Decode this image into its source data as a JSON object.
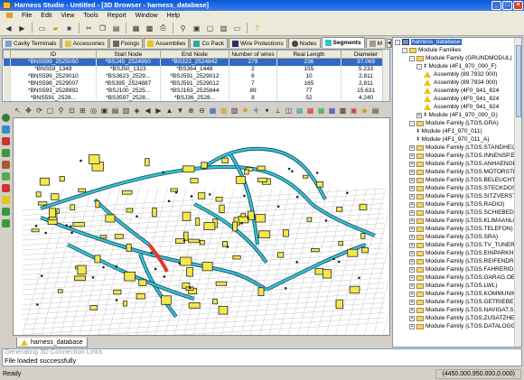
{
  "window": {
    "title": "Harness Studio - Untitled - [3D Browser - harness_database]"
  },
  "menu": [
    "File",
    "Edit",
    "View",
    "Tools",
    "Report",
    "Window",
    "Help"
  ],
  "tabs": [
    {
      "label": "Cavity Terminals",
      "icon": "cavity-terminal-icon"
    },
    {
      "label": "Accessories",
      "icon": "accessory-icon"
    },
    {
      "label": "Fixings",
      "icon": "fixing-icon"
    },
    {
      "label": "Assemblies",
      "icon": "assembly-icon"
    },
    {
      "label": "Co Pack",
      "icon": "copack-icon"
    },
    {
      "label": "Wire Protections",
      "icon": "wire-protection-icon"
    },
    {
      "label": "Nodes",
      "icon": "node-icon"
    },
    {
      "label": "Segments",
      "icon": "segment-icon"
    },
    {
      "label": "M",
      "icon": "more-icon"
    }
  ],
  "grid": {
    "columns": [
      "ID",
      "Start Node",
      "End Node",
      "Number of wires",
      "Real Length",
      "Diameter"
    ],
    "rows": [
      [
        "*BNS599_2525050",
        "*BSJ45_2524950",
        "*BS322_2524842",
        "279",
        "236",
        "37.069"
      ],
      [
        "*BNS59_1349",
        "*BSJ50_1323",
        "*BS364_1448",
        "2",
        "155",
        "5.233"
      ],
      [
        "*BNS599_2529010",
        "*BS3623_2529...",
        "*BSJ591_2529012",
        "6",
        "10",
        "2.811"
      ],
      [
        "*BNS598_2529007",
        "*BS395_2524887",
        "*BSJ591_2529012",
        "7",
        "165",
        "2.811"
      ],
      [
        "*BNS593_2528992",
        "*BSJ100_2525...",
        "*BSJ163_2525844",
        "89",
        "77",
        "15.631"
      ],
      [
        "*BNS591_2528...",
        "*BS3597_2528...",
        "*BSJ36_2528...",
        "8",
        "52",
        "4.240"
      ]
    ]
  },
  "tree": [
    {
      "level": 0,
      "label": "harness_database",
      "type": "db",
      "expanded": "-"
    },
    {
      "level": 1,
      "label": "Module Families",
      "type": "folder",
      "expanded": "-"
    },
    {
      "level": 2,
      "label": "Module Family (GRUNDMODUL)",
      "type": "folder",
      "expanded": "-"
    },
    {
      "level": 3,
      "label": "Module (4F1_970_000_F)",
      "type": "module",
      "expanded": "-"
    },
    {
      "level": 4,
      "label": "Assembly (89 7932 000)",
      "type": "warn"
    },
    {
      "level": 4,
      "label": "Assembly (89 7934 000)",
      "type": "warn"
    },
    {
      "level": 4,
      "label": "Assembly (4F0_941_824",
      "type": "warn"
    },
    {
      "level": 4,
      "label": "Assembly (4F0_941_824",
      "type": "warn"
    },
    {
      "level": 4,
      "label": "Assembly (4F0_941_824",
      "type": "warn"
    },
    {
      "level": 3,
      "label": "Module (4F1_970_000_G)",
      "type": "module",
      "expanded": "+"
    },
    {
      "level": 2,
      "label": "Module Family (LTGS.GRA)",
      "type": "folder",
      "expanded": "-"
    },
    {
      "level": 3,
      "label": "Module (4F1_970_011)",
      "type": "module"
    },
    {
      "level": 3,
      "label": "Module (4F1_970_011_A)",
      "type": "module"
    },
    {
      "level": 2,
      "label": "Module Family (LTGS.STANDHEIZ",
      "type": "folder",
      "expanded": "+"
    },
    {
      "level": 2,
      "label": "Module Family (LTGS.INNENSP.E",
      "type": "folder",
      "expanded": "+"
    },
    {
      "level": 2,
      "label": "Module Family (LTGS.ANHAENGE",
      "type": "folder",
      "expanded": "+"
    },
    {
      "level": 2,
      "label": "Module Family (LTGS.MOTORSTE",
      "type": "folder",
      "expanded": "+"
    },
    {
      "level": 2,
      "label": "Module Family (LTGS.BELEUCHT",
      "type": "folder",
      "expanded": "+"
    },
    {
      "level": 2,
      "label": "Module Family (LTGS.STECKDOS",
      "type": "folder",
      "expanded": "+"
    },
    {
      "level": 2,
      "label": "Module Family (LTGS.SITZVERST",
      "type": "folder",
      "expanded": "+"
    },
    {
      "level": 2,
      "label": "Module Family (LTGS.RADIO)",
      "type": "folder",
      "expanded": "+"
    },
    {
      "level": 2,
      "label": "Module Family (LTGS.SCHIEBEDA",
      "type": "folder",
      "expanded": "+"
    },
    {
      "level": 2,
      "label": "Module Family (LTGS.KLIMAANL/",
      "type": "folder",
      "expanded": "+"
    },
    {
      "level": 2,
      "label": "Module Family (LTGS.TELEFON)",
      "type": "folder",
      "expanded": "+"
    },
    {
      "level": 2,
      "label": "Module Family (LTGS.SRA)",
      "type": "folder",
      "expanded": "+"
    },
    {
      "level": 2,
      "label": "Module Family (LTGS.TV_TUNER)",
      "type": "folder",
      "expanded": "+"
    },
    {
      "level": 2,
      "label": "Module Family (LTGS.EINPARKH",
      "type": "folder",
      "expanded": "+"
    },
    {
      "level": 2,
      "label": "Module Family (LTGS.REIFENDR",
      "type": "folder",
      "expanded": "+"
    },
    {
      "level": 2,
      "label": "Module Family (LTGS.FAHRERID",
      "type": "folder",
      "expanded": "+"
    },
    {
      "level": 2,
      "label": "Module Family (LTGS.GARAG.OE",
      "type": "folder",
      "expanded": "+"
    },
    {
      "level": 2,
      "label": "Module Family (LTGS.LWL)",
      "type": "folder",
      "expanded": "+"
    },
    {
      "level": 2,
      "label": "Module Family (LTGS.KOMMUNIK",
      "type": "folder",
      "expanded": "+"
    },
    {
      "level": 2,
      "label": "Module Family (LTGS.GETRIEBE)",
      "type": "folder",
      "expanded": "+"
    },
    {
      "level": 2,
      "label": "Module Family (LTGS.NAVIGAT.S",
      "type": "folder",
      "expanded": "+"
    },
    {
      "level": 2,
      "label": "Module Family (LTGS.ZUSATZHE",
      "type": "folder",
      "expanded": "+"
    },
    {
      "level": 2,
      "label": "Module Family (LTGS.DATALOGG",
      "type": "folder",
      "expanded": "+"
    }
  ],
  "bottom_tab": {
    "label": "harness_database"
  },
  "output": {
    "previous": "Generating 3D Connection Links",
    "message": "File loaded successfully"
  },
  "status": {
    "left": "Ready",
    "coords": "(4450.000,950.000,0.000)"
  },
  "colors": {
    "titlebar": "#0a58d8",
    "selection": "#316ac5",
    "harness_cyan": "#2fc8c8",
    "connector_yellow": "#f2e84a",
    "highlight_red": "#e03a2a"
  }
}
